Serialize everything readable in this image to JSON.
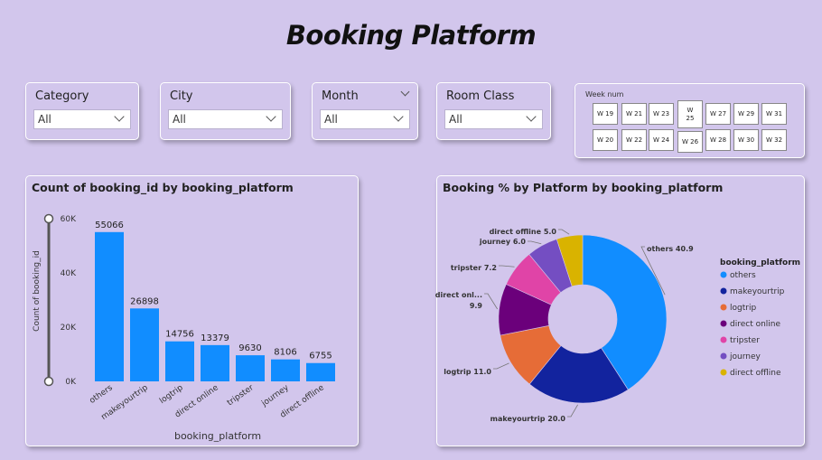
{
  "page": {
    "title": "Booking Platform"
  },
  "slicers": {
    "category": {
      "label": "Category",
      "value": "All"
    },
    "city": {
      "label": "City",
      "value": "All"
    },
    "month": {
      "label": "Month",
      "value": "All"
    },
    "room_class": {
      "label": "Room Class",
      "value": "All"
    }
  },
  "week_slicer": {
    "title": "Week num",
    "row1": [
      "W 19",
      "W 21",
      "W 23",
      "W 25",
      "W 27",
      "W 29",
      "W 31"
    ],
    "row2": [
      "W 20",
      "W 22",
      "W 24",
      "W 26",
      "W 28",
      "W 30",
      "W 32"
    ]
  },
  "colors": {
    "background": "#d2c6ec",
    "bar": "#118dff",
    "others": "#118dff",
    "makeyourtrip": "#12239e",
    "logtrip": "#e66c37",
    "direct online": "#6b007b",
    "tripster": "#e044a7",
    "journey": "#744ec2",
    "direct offline": "#d9b300"
  },
  "chart_data": [
    {
      "type": "bar",
      "title": "Count of booking_id by booking_platform",
      "xlabel": "booking_platform",
      "ylabel": "Count of booking_id",
      "categories": [
        "others",
        "makeyourtrip",
        "logtrip",
        "direct online",
        "tripster",
        "journey",
        "direct offline"
      ],
      "values": [
        55066,
        26898,
        14756,
        13379,
        9630,
        8106,
        6755
      ],
      "ylim": [
        0,
        60000
      ],
      "yticks": [
        {
          "v": 0,
          "label": "0K"
        },
        {
          "v": 20000,
          "label": "20K"
        },
        {
          "v": 40000,
          "label": "40K"
        },
        {
          "v": 60000,
          "label": "60K"
        }
      ],
      "grid": false
    },
    {
      "type": "pie",
      "title": "Booking % by Platform by booking_platform",
      "legend_title": "booking_platform",
      "legend_position": "right",
      "slices": [
        {
          "name": "others",
          "value": 40.9,
          "label": "others 40.9"
        },
        {
          "name": "makeyourtrip",
          "value": 20.0,
          "label": "makeyourtrip 20.0"
        },
        {
          "name": "logtrip",
          "value": 11.0,
          "label": "logtrip 11.0"
        },
        {
          "name": "direct online",
          "value": 9.9,
          "label": "direct onl...",
          "label2": "9.9"
        },
        {
          "name": "tripster",
          "value": 7.2,
          "label": "tripster 7.2"
        },
        {
          "name": "journey",
          "value": 6.0,
          "label": "journey 6.0"
        },
        {
          "name": "direct offline",
          "value": 5.0,
          "label": "direct offline 5.0"
        }
      ]
    }
  ]
}
